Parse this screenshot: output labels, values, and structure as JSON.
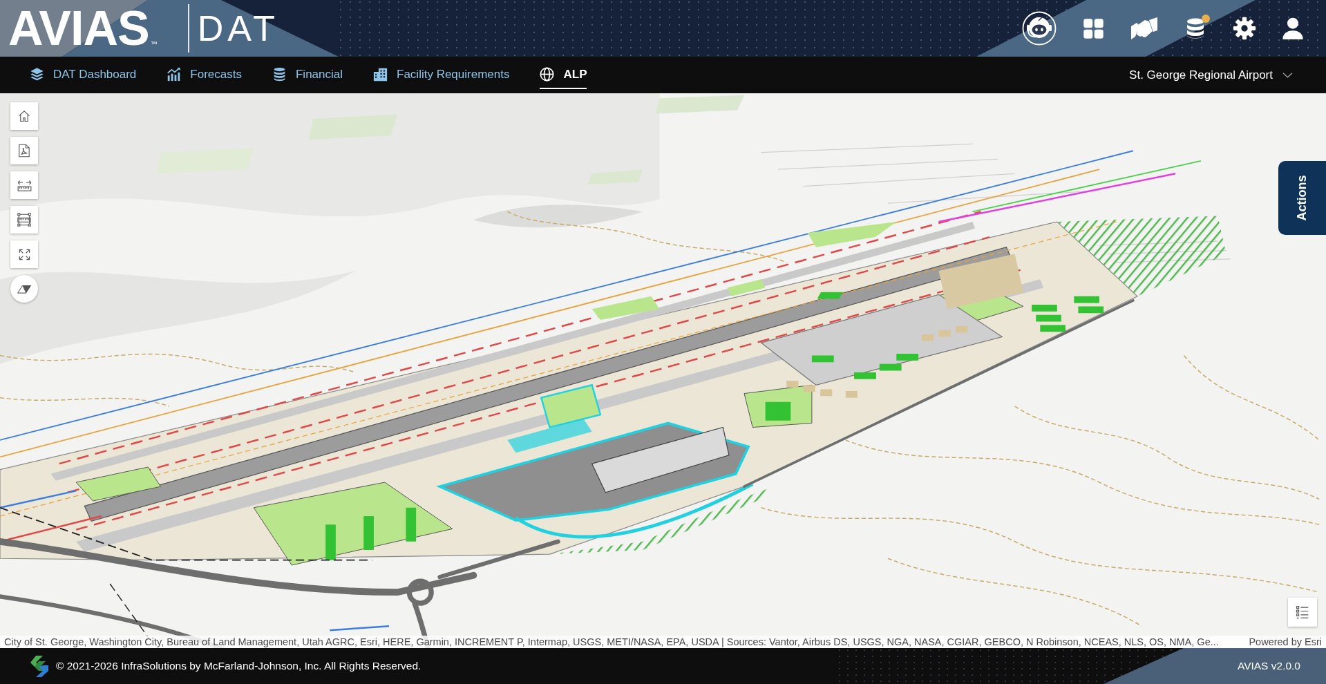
{
  "header": {
    "logo": "AVIAS",
    "trademark": "™",
    "product": "DAT",
    "database_badge": true
  },
  "nav_tabs": [
    {
      "label": "DAT Dashboard",
      "selected": false
    },
    {
      "label": "Forecasts",
      "selected": false
    },
    {
      "label": "Financial",
      "selected": false
    },
    {
      "label": "Facility Requirements",
      "selected": false
    },
    {
      "label": "ALP",
      "selected": true
    }
  ],
  "airport_selector": {
    "value": "St. George Regional Airport"
  },
  "actions_tab": {
    "label": "Actions"
  },
  "attribution": {
    "sources": "City of St. George, Washington City, Bureau of Land Management, Utah AGRC, Esri, HERE, Garmin, INCREMENT P, Intermap, USGS, METI/NASA, EPA, USDA | Sources: Vantor, Airbus DS, USGS, NGA, NASA, CGIAR, GEBCO, N Robinson, NCEAS, NLS, OS, NMA, Ge...",
    "powered_by": "Powered by Esri"
  },
  "footer": {
    "copyright": "© 2021-2026 InfraSolutions by McFarland-Johnson, Inc. All Rights Reserved.",
    "version": "AVIAS v2.0.0"
  }
}
